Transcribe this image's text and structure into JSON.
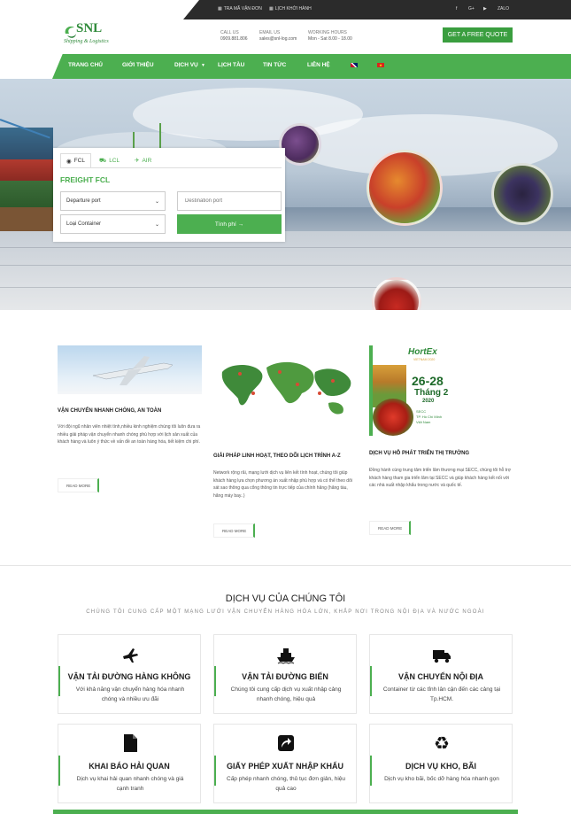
{
  "topbar": {
    "track_label": "TRA MÃ VẬN ĐƠN",
    "schedule_label": "LỊCH KHỞI HÀNH",
    "social": [
      "f",
      "G+",
      "▶",
      "ZALO"
    ]
  },
  "header": {
    "logo_text": "SNL",
    "logo_sub": "Shipping & Logistics",
    "call_label": "CALL US",
    "call_value": "0909.881.806",
    "email_label": "EMAIL US",
    "email_value": "sales@snl-log.com",
    "hours_label": "WORKING HOURS",
    "hours_value": "Mon - Sat 8.00 - 18.00",
    "quote_button": "GET A FREE QUOTE"
  },
  "nav": {
    "items": [
      "TRANG CHỦ",
      "GIỚI THIỆU",
      "DỊCH VỤ",
      "LỊCH TÀU",
      "TIN TỨC",
      "LIÊN HỆ"
    ]
  },
  "quote_form": {
    "tabs": [
      "FCL",
      "LCL",
      "AIR"
    ],
    "heading": "FREIGHT FCL",
    "departure_value": "Departure port",
    "destination_placeholder": "Destination port",
    "container_value": "Loại Container",
    "calc_button": "Tính phí →"
  },
  "features": [
    {
      "title": "VẬN CHUYỂN NHANH CHÓNG, AN TOÀN",
      "text": "Với đội ngũ nhân viên nhiệt tình,nhiều kinh nghiệm chúng tôi luôn đưa ra nhiều giải pháp vận chuyển nhanh chóng phù hợp với lịch sản xuất của khách hàng và luôn ý thức về vấn đề an toàn hàng hóa, tiết kiệm chi phí.",
      "read_more": "READ MORE"
    },
    {
      "title": "GIẢI PHÁP LINH HOẠT, THEO DÕI LỊCH TRÌNH A-Z",
      "text": "Network rộng rãi, mạng lưới dịch vụ liên kết tính hoạt, chúng tôi giúp khách hàng lựa chọn phương án xuất nhập phù hợp và có thể theo dõi sát sao thông qua cổng thông tin trực tiếp của chính hãng (hãng tàu, hãng máy bay..)",
      "read_more": "READ MORE"
    },
    {
      "title": "DỊCH VỤ HỖ PHÁT TRIỂN THỊ TRƯỜNG",
      "text": "Đồng hành cùng trung tâm triển lãm thương mại SECC, chúng tôi hỗ trợ khách hàng tham gia triển lãm tại SECC và giúp khách hàng kết nối với các nhà xuất nhập khẩu trong nước và quốc tế.",
      "read_more": "READ MORE",
      "poster": {
        "brand": "HortEx",
        "brand_sub": "VIETNAM 2020",
        "date": "26-28",
        "month": "Tháng 2",
        "year": "2020",
        "venue_1": "SECC",
        "venue_2": "TP. Hồ Chí Minh",
        "venue_3": "Việt Nam"
      }
    }
  ],
  "services": {
    "title": "DỊCH VỤ CỦA CHÚNG TÔI",
    "subtitle": "CHÚNG TÔI CUNG CẤP MỘT MẠNG LƯỚI VẬN CHUYỂN HÀNG HÓA LỚN, KHẮP NƠI TRONG NỘI ĐỊA VÀ NƯỚC NGOÀI",
    "cards": [
      {
        "icon": "airplane-icon",
        "title": "VẬN TẢI ĐƯỜNG HÀNG KHÔNG",
        "text": "Với khả năng vận chuyển hàng hóa nhanh chóng và nhiều ưu đãi"
      },
      {
        "icon": "ship-icon",
        "title": "VẬN TẢI ĐƯỜNG BIỂN",
        "text": "Chúng tôi cung cấp dịch vụ xuất nhập cảng nhanh chóng, hiệu quả"
      },
      {
        "icon": "truck-icon",
        "title": "VẬN CHUYỂN NỘI ĐỊA",
        "text": "Container từ các tỉnh lân cận đến các cảng tại Tp.HCM."
      },
      {
        "icon": "document-icon",
        "title": "KHAI BÁO HẢI QUAN",
        "text": "Dịch vụ khai hải quan nhanh chóng và giá cạnh tranh"
      },
      {
        "icon": "share-icon",
        "title": "GIẤY PHÉP XUẤT NHẬP KHẨU",
        "text": "Cấp phép nhanh chóng, thủ tục đơn giản, hiệu quả cao"
      },
      {
        "icon": "recycle-icon",
        "title": "DỊCH VỤ KHO, BÃI",
        "text": "Dịch vụ kho bãi, bốc dỡ hàng hóa nhanh gọn"
      }
    ]
  },
  "colors": {
    "accent": "#4caf50",
    "topbar": "#2b2b2b"
  }
}
